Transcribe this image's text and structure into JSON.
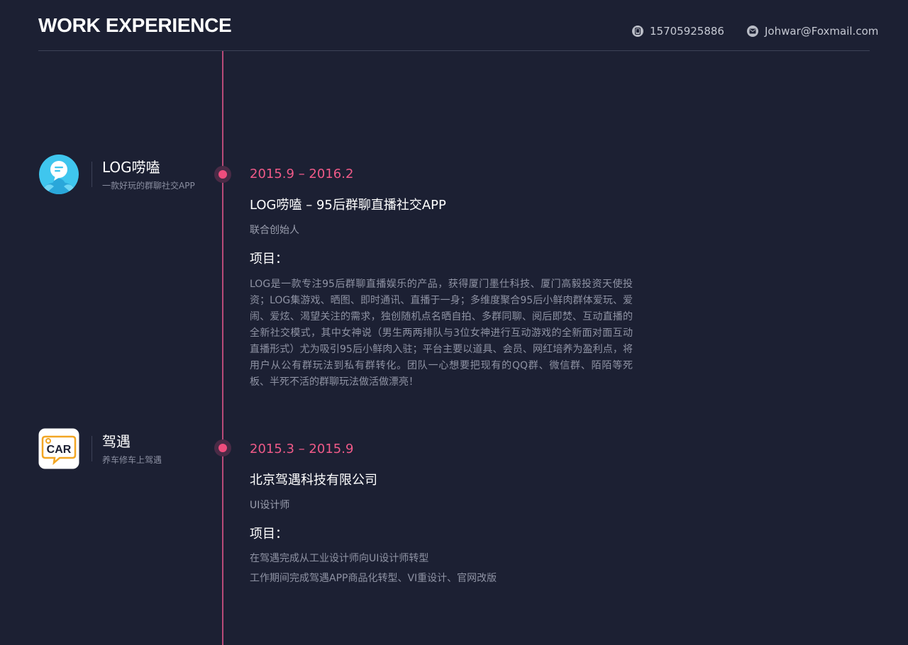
{
  "header": {
    "title": "WORK EXPERIENCE",
    "phone": "15705925886",
    "email": "Johwar@Foxmail.com"
  },
  "colors": {
    "background": "#1c2033",
    "accent": "#ef4d7d",
    "timeline": "#b84a78"
  },
  "experiences": [
    {
      "company_name": "LOG唠嗑",
      "company_tagline": "一款好玩的群聊社交APP",
      "logo_icon": "chat-bubble-person-icon",
      "period": "2015.9 – 2016.2",
      "title": "LOG唠嗑 – 95后群聊直播社交APP",
      "role": "联合创始人",
      "project_label": "项目：",
      "description": "LOG是一款专注95后群聊直播娱乐的产品，获得厦门墨仕科技、厦门高毅投资天使投资；LOG集游戏、晒图、即时通讯、直播于一身；多维度聚合95后小鲜肉群体爱玩、爱闹、爱炫、渴望关注的需求，独创随机点名晒自拍、多群同聊、阅后即焚、互动直播的全新社交模式，其中女神说（男生两两排队与3位女神进行互动游戏的全新面对面互动直播形式）尤为吸引95后小鲜肉入驻；平台主要以道具、会员、网红培养为盈利点，将用户从公有群玩法到私有群转化。团队一心想要把现有的QQ群、微信群、陌陌等死板、半死不活的群聊玩法做活做漂亮！"
    },
    {
      "company_name": "驾遇",
      "company_tagline": "养车修车上驾遇",
      "logo_icon": "car-speech-bubble-icon",
      "logo_text": "CAR",
      "period": "2015.3 – 2015.9",
      "title": "北京驾遇科技有限公司",
      "role": "UI设计师",
      "project_label": "项目：",
      "description_lines": [
        "在驾遇完成从工业设计师向UI设计师转型",
        "工作期间完成驾遇APP商品化转型、VI重设计、官网改版"
      ]
    }
  ]
}
